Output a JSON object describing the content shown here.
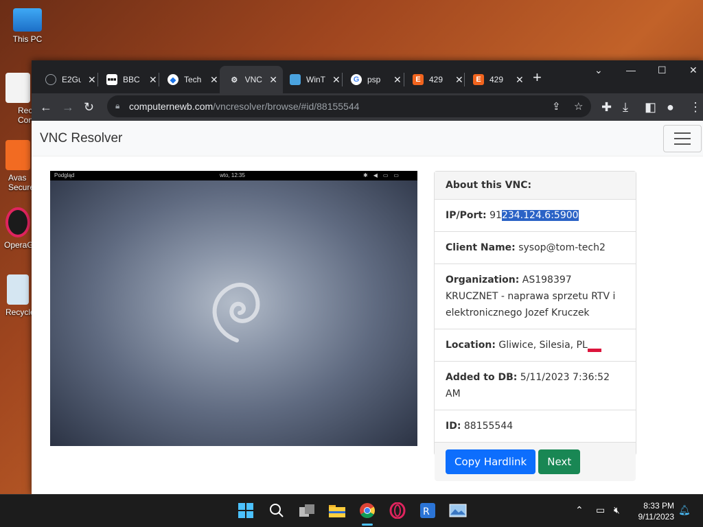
{
  "desktop": {
    "icons": [
      {
        "label": "This PC"
      },
      {
        "label": "Rectif Contr"
      },
      {
        "label": "Avas Secure"
      },
      {
        "label": "OperaG"
      },
      {
        "label": "Recycle"
      }
    ]
  },
  "browser": {
    "tabs": [
      {
        "title": "E2Gu",
        "icon": "globe-icon"
      },
      {
        "title": "BBC",
        "icon": "bbc-icon"
      },
      {
        "title": "Tech",
        "icon": "tech-icon"
      },
      {
        "title": "VNC",
        "icon": "vnc-icon"
      },
      {
        "title": "WinT",
        "icon": "win-icon"
      },
      {
        "title": "psp",
        "icon": "google-icon"
      },
      {
        "title": "429",
        "icon": "etsy-icon"
      },
      {
        "title": "429",
        "icon": "etsy-icon"
      }
    ],
    "url_domain": "computernewb.com",
    "url_path": "/vncresolver/browse/#id/88155544"
  },
  "page": {
    "brand": "VNC Resolver",
    "preview": {
      "left_label": "Podgląd",
      "center_label": "wto, 12:35"
    },
    "card": {
      "header": "About this VNC:",
      "ip_label": "IP/Port:",
      "ip_prefix": "91",
      "ip_selected": "234.124.6:5900",
      "client_label": "Client Name:",
      "client_value": "sysop@tom-tech2",
      "org_label": "Organization:",
      "org_value": "AS198397 KRUCZNET - naprawa sprzetu RTV i elektronicznego Jozef Kruczek",
      "location_label": "Location:",
      "location_value": "Gliwice, Silesia, PL",
      "added_label": "Added to DB:",
      "added_value": "5/11/2023 7:36:52 AM",
      "id_label": "ID:",
      "id_value": "88155544",
      "copy_button": "Copy Hardlink",
      "next_button": "Next"
    }
  },
  "taskbar": {
    "time": "8:33 PM",
    "date": "9/11/2023"
  },
  "colors": {
    "selection": "#2b63c6",
    "primary_button": "#0d6efd",
    "success_button": "#198754",
    "flag_red": "#dc143c"
  }
}
